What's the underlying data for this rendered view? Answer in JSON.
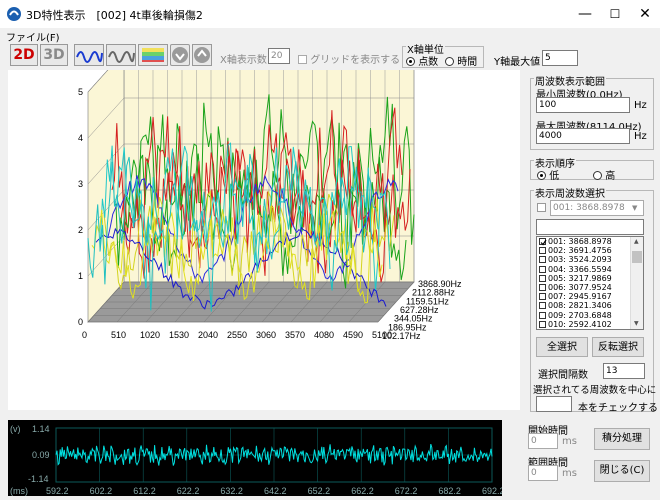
{
  "window": {
    "title": "3D特性表示　[002] 4t車後輪損傷2",
    "min": "—",
    "max": "☐",
    "close": "✕"
  },
  "menu": {
    "file": "ファイル(F)"
  },
  "toolbar": {
    "btn_2d": "2D",
    "btn_3d": "3D",
    "x_count_label": "X軸表示数",
    "x_count_value": "20",
    "grid_label": "グリッドを表示する",
    "x_unit_label": "X軸単位",
    "x_unit_points": "点数",
    "x_unit_time": "時間",
    "y_max_label": "Y軸最大値",
    "y_max_value": "5"
  },
  "freq_range": {
    "title": "周波数表示範囲",
    "min_label": "最小周波数(0.0Hz)",
    "min_value": "100",
    "min_unit": "Hz",
    "max_label": "最大周波数(8114.0Hz)",
    "max_value": "4000",
    "max_unit": "Hz"
  },
  "order": {
    "title": "表示順序",
    "low": "低",
    "high": "高"
  },
  "freq_select": {
    "title": "表示周波数選択",
    "combo_value": "001: 3868.8978",
    "items": [
      "001: 3868.8978",
      "002: 3691.4756",
      "003: 3524.2093",
      "004: 3366.5594",
      "005: 3217.9869",
      "006: 3077.9524",
      "007: 2945.9167",
      "008: 2821.3406",
      "009: 2703.6848",
      "010: 2592.4102"
    ],
    "select_all": "全選択",
    "invert": "反転選択",
    "interval_label": "選択間隔数",
    "interval_value": "13",
    "center_label": "選択されてる周波数を中心に",
    "center_suffix": "本をチェックする"
  },
  "time": {
    "start_label": "開始時間",
    "start_value": "0",
    "start_unit": "ms",
    "range_label": "範囲時間",
    "range_value": "0",
    "range_unit": "ms",
    "integrate": "積分処理",
    "close": "閉じる(C)"
  },
  "chart3d": {
    "y_ticks": [
      "0",
      "1",
      "2",
      "3",
      "4",
      "5"
    ],
    "x_ticks": [
      "0",
      "510",
      "1020",
      "1530",
      "2040",
      "2550",
      "3060",
      "3570",
      "4080",
      "4590",
      "5100"
    ],
    "z_ticks": [
      "3868.90Hz",
      "2112.88Hz",
      "1159.51Hz",
      "627.28Hz",
      "344.05Hz",
      "186.95Hz",
      "102.17Hz"
    ]
  },
  "waveform": {
    "unit": "(v)",
    "y_top": "1.14",
    "y_mid": "0.09",
    "y_bot": "-1.14",
    "x_unit": "(ms)",
    "x_ticks": [
      "592.2",
      "602.2",
      "612.2",
      "622.2",
      "632.2",
      "642.2",
      "652.2",
      "662.2",
      "672.2",
      "682.2",
      "692.2"
    ],
    "colors": {
      "bg": "#000000",
      "trace": "#00e0e0",
      "grid": "#0c5a5a"
    }
  }
}
